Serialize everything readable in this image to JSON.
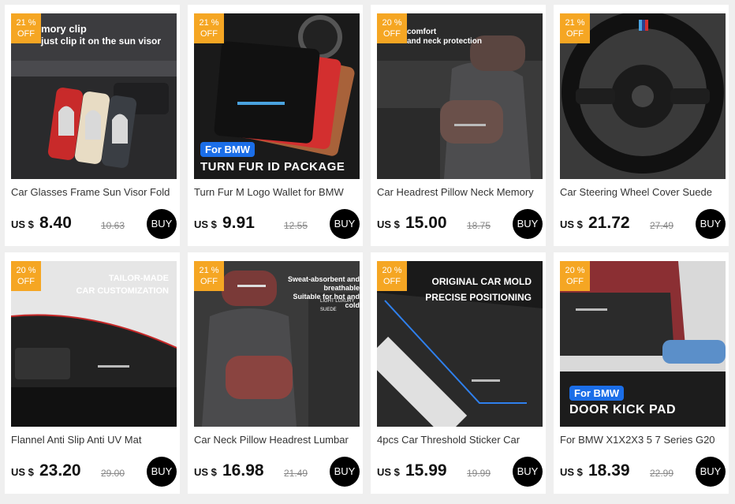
{
  "products": [
    {
      "title": "Car Glasses Frame Sun Visor Fold",
      "currency": "US $",
      "price": "8.40",
      "old_price": "10.63",
      "discount": "21 %",
      "off": "OFF",
      "buy": "BUY",
      "overlay": [
        "mory clip",
        "just clip it on the sun visor"
      ]
    },
    {
      "title": "Turn Fur M Logo Wallet for BMW",
      "currency": "US $",
      "price": "9.91",
      "old_price": "12.55",
      "discount": "21 %",
      "off": "OFF",
      "buy": "BUY",
      "tag": "For BMW",
      "headline": "TURN FUR ID PACKAGE"
    },
    {
      "title": "Car Headrest Pillow Neck Memory",
      "currency": "US $",
      "price": "15.00",
      "old_price": "18.75",
      "discount": "20 %",
      "off": "OFF",
      "buy": "BUY",
      "overlay": [
        "comfort",
        "and neck protection"
      ]
    },
    {
      "title": "Car Steering Wheel Cover Suede",
      "currency": "US $",
      "price": "21.72",
      "old_price": "27.49",
      "discount": "21 %",
      "off": "OFF",
      "buy": "BUY"
    },
    {
      "title": "Flannel Anti Slip Anti UV Mat",
      "currency": "US $",
      "price": "23.20",
      "old_price": "29.00",
      "discount": "20 %",
      "off": "OFF",
      "buy": "BUY",
      "overlay": [
        "TAILOR-MADE",
        "CAR CUSTOMIZATION"
      ]
    },
    {
      "title": "Car Neck Pillow Headrest Lumbar",
      "currency": "US $",
      "price": "16.98",
      "old_price": "21.49",
      "discount": "21 %",
      "off": "OFF",
      "buy": "BUY",
      "overlay": [
        "Sweat-absorbent and breathable",
        "Suitable for hot and cold",
        "LIGHT LUXURY SUEDE"
      ]
    },
    {
      "title": "4pcs Car Threshold Sticker Car",
      "currency": "US $",
      "price": "15.99",
      "old_price": "19.99",
      "discount": "20 %",
      "off": "OFF",
      "buy": "BUY",
      "overlay": [
        "ORIGINAL CAR MOLD",
        "PRECISE POSITIONING"
      ]
    },
    {
      "title": "For BMW X1X2X3 5 7 Series G20",
      "currency": "US $",
      "price": "18.39",
      "old_price": "22.99",
      "discount": "20 %",
      "off": "OFF",
      "buy": "BUY",
      "tag": "For BMW",
      "headline": "DOOR KICK PAD"
    }
  ],
  "colors": {
    "badge": "#f5a623",
    "buy": "#000000",
    "tag": "#1b6ee8"
  }
}
